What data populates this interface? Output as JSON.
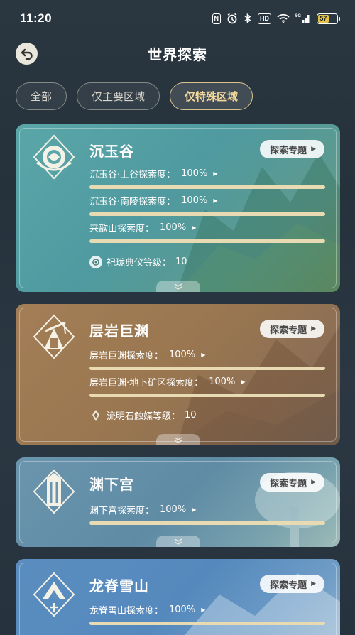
{
  "status_bar": {
    "time": "11:20",
    "nfc": "N",
    "hd": "HD",
    "net": "5G",
    "battery": "57"
  },
  "header": {
    "title": "世界探索"
  },
  "tabs": [
    {
      "label": "全部",
      "active": false
    },
    {
      "label": "仅主要区域",
      "active": false
    },
    {
      "label": "仅特殊区域",
      "active": true
    }
  ],
  "cards": [
    {
      "name": "沉玉谷",
      "topic_label": "探索专题",
      "progress": [
        {
          "label": "沉玉谷·上谷探索度：",
          "value": "100%",
          "fraction": 1.0
        },
        {
          "label": "沉玉谷·南陵探索度：",
          "value": "100%",
          "fraction": 1.0
        },
        {
          "label": "来歆山探索度：",
          "value": "100%",
          "fraction": 1.0
        }
      ],
      "level_label": "祀珑典仪等级：",
      "level_value": "10"
    },
    {
      "name": "层岩巨渊",
      "topic_label": "探索专题",
      "progress": [
        {
          "label": "层岩巨渊探索度：",
          "value": "100%",
          "fraction": 1.0
        },
        {
          "label": "层岩巨渊·地下矿区探索度：",
          "value": "100%",
          "fraction": 1.0
        }
      ],
      "level_label": "流明石触媒等级：",
      "level_value": "10"
    },
    {
      "name": "渊下宫",
      "topic_label": "探索专题",
      "progress": [
        {
          "label": "渊下宫探索度：",
          "value": "100%",
          "fraction": 1.0
        }
      ]
    },
    {
      "name": "龙脊雪山",
      "topic_label": "探索专题",
      "progress": [
        {
          "label": "龙脊雪山探索度：",
          "value": "100%",
          "fraction": 1.0
        }
      ]
    }
  ]
}
